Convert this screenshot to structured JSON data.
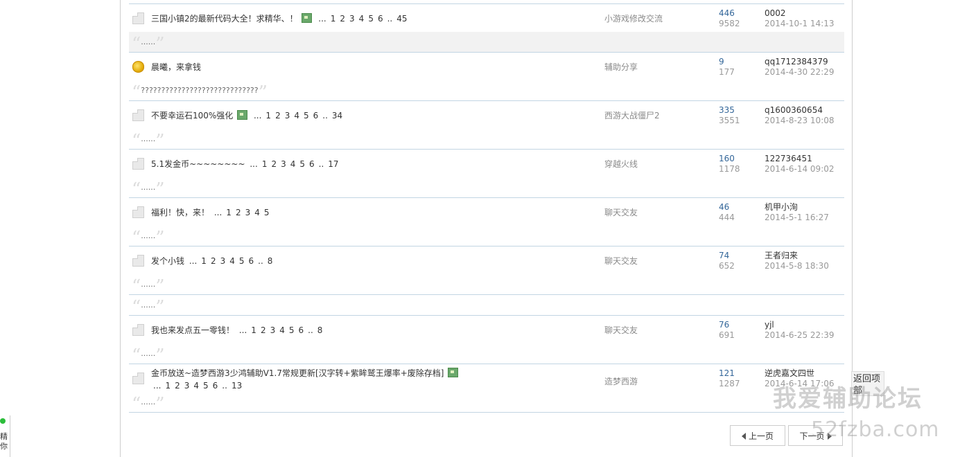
{
  "threads": [
    {
      "title": "三国小镇2的最新代码大全！求精华、！",
      "has_img": true,
      "pages": [
        "...",
        "1",
        "2",
        "3",
        "4",
        "5",
        "6",
        "..",
        "45"
      ],
      "forum": "小游戏修改交流",
      "replies": "446",
      "views": "9582",
      "last_user": "0002",
      "last_time": "2014-10-1 14:13",
      "quote": "......",
      "icon": "folder",
      "highlight": true
    },
    {
      "title": "晨曦，来拿钱",
      "has_img": false,
      "pages": [],
      "forum": "辅助分享",
      "replies": "9",
      "views": "177",
      "last_user": "qq1712384379",
      "last_time": "2014-4-30 22:29",
      "quote": "?????????????????????????????",
      "icon": "gold"
    },
    {
      "title": "不要幸运石100%强化",
      "has_img": true,
      "pages": [
        "...",
        "1",
        "2",
        "3",
        "4",
        "5",
        "6",
        "..",
        "34"
      ],
      "forum": "西游大战僵尸2",
      "replies": "335",
      "views": "3551",
      "last_user": "q1600360654",
      "last_time": "2014-8-23 10:08",
      "quote": "......",
      "icon": "folder"
    },
    {
      "title": "5.1发金币~~~~~~~~",
      "has_img": false,
      "pages": [
        "...",
        "1",
        "2",
        "3",
        "4",
        "5",
        "6",
        "..",
        "17"
      ],
      "forum": "穿越火线",
      "replies": "160",
      "views": "1178",
      "last_user": "122736451",
      "last_time": "2014-6-14 09:02",
      "quote": "......",
      "icon": "folder"
    },
    {
      "title": "福利！快，来！",
      "has_img": false,
      "pages": [
        "...",
        "1",
        "2",
        "3",
        "4",
        "5"
      ],
      "forum": "聊天交友",
      "replies": "46",
      "views": "444",
      "last_user": "机甲小洵",
      "last_time": "2014-5-1 16:27",
      "quote": "......",
      "icon": "folder"
    },
    {
      "title": "发个小钱",
      "has_img": false,
      "pages": [
        "...",
        "1",
        "2",
        "3",
        "4",
        "5",
        "6",
        "..",
        "8"
      ],
      "forum": "聊天交友",
      "replies": "74",
      "views": "652",
      "last_user": "王者归来",
      "last_time": "2014-5-8 18:30",
      "quote": "......",
      "icon": "folder"
    },
    {
      "short": true,
      "quote": "......"
    },
    {
      "title": "我也来发点五一零钱！",
      "has_img": false,
      "pages": [
        "...",
        "1",
        "2",
        "3",
        "4",
        "5",
        "6",
        "..",
        "8"
      ],
      "forum": "聊天交友",
      "replies": "76",
      "views": "691",
      "last_user": "yjl",
      "last_time": "2014-6-25 22:39",
      "quote": "......",
      "icon": "folder"
    },
    {
      "title": "金币放送~造梦西游3少鸿辅助V1.7常规更新[汉字转+紫眸鹫王爆率+废除存档]",
      "has_img": true,
      "pages": [
        "...",
        "1",
        "2",
        "3",
        "4",
        "5",
        "6",
        "..",
        "13"
      ],
      "forum": "造梦西游",
      "replies": "121",
      "views": "1287",
      "last_user": "逆虎嘉文四世",
      "last_time": "2014-6-14 17:06",
      "quote": "......",
      "icon": "folder",
      "two_line": true
    }
  ],
  "pager": {
    "prev": "上一页",
    "next": "下一页"
  },
  "back_to_top": "返回项部",
  "watermark": "我爱辅助论坛",
  "watermark_url": "52fzba.com",
  "side_widget": "精你"
}
